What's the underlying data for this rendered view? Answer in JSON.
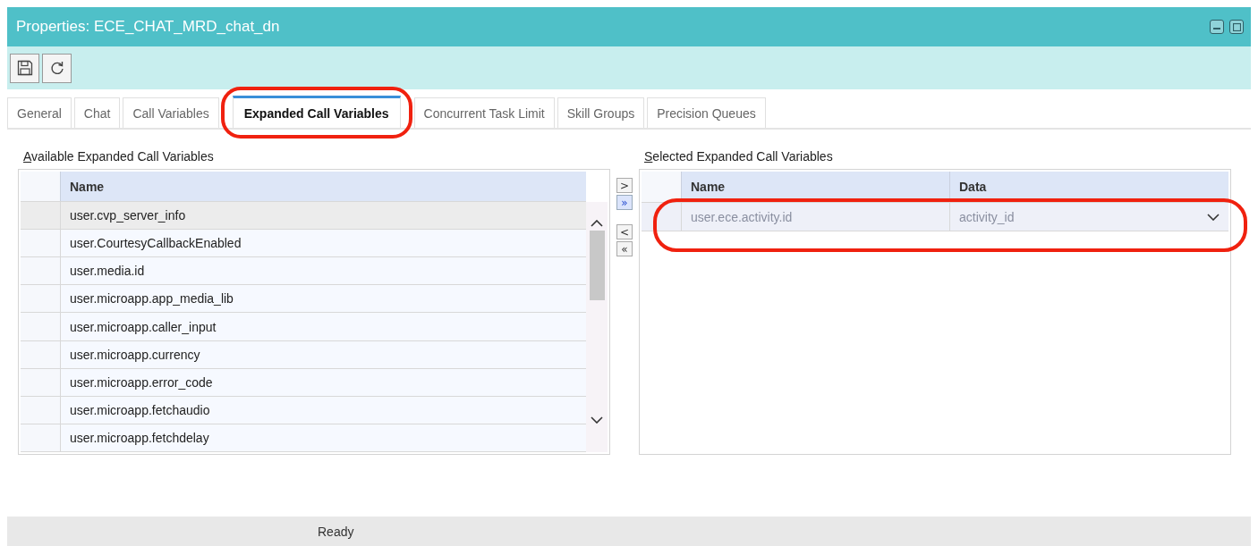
{
  "window": {
    "title": "Properties: ECE_CHAT_MRD_chat_dn"
  },
  "tabs": [
    {
      "label": "General",
      "selected": false
    },
    {
      "label": "Chat",
      "selected": false
    },
    {
      "label": "Call Variables",
      "selected": false
    },
    {
      "label": "Expanded Call Variables",
      "selected": true
    },
    {
      "label": "Concurrent Task Limit",
      "selected": false
    },
    {
      "label": "Skill Groups",
      "selected": false
    },
    {
      "label": "Precision Queues",
      "selected": false
    }
  ],
  "available": {
    "label": "Available Expanded Call Variables",
    "columns": [
      "Name"
    ],
    "rows": [
      {
        "name": "user.cvp_server_info",
        "selected": true
      },
      {
        "name": "user.CourtesyCallbackEnabled",
        "selected": false
      },
      {
        "name": "user.media.id",
        "selected": false
      },
      {
        "name": "user.microapp.app_media_lib",
        "selected": false
      },
      {
        "name": "user.microapp.caller_input",
        "selected": false
      },
      {
        "name": "user.microapp.currency",
        "selected": false
      },
      {
        "name": "user.microapp.error_code",
        "selected": false
      },
      {
        "name": "user.microapp.fetchaudio",
        "selected": false
      },
      {
        "name": "user.microapp.fetchdelay",
        "selected": false
      }
    ]
  },
  "transfer_buttons": [
    {
      "label": ">",
      "selected": false
    },
    {
      "label": "»",
      "selected": true
    },
    {
      "label": "<",
      "selected": false
    },
    {
      "label": "«",
      "selected": false
    }
  ],
  "selected": {
    "label": "Selected Expanded Call Variables",
    "columns": [
      "Name",
      "Data"
    ],
    "rows": [
      {
        "name": "user.ece.activity.id",
        "data": "activity_id"
      }
    ]
  },
  "status_bar": "Ready"
}
